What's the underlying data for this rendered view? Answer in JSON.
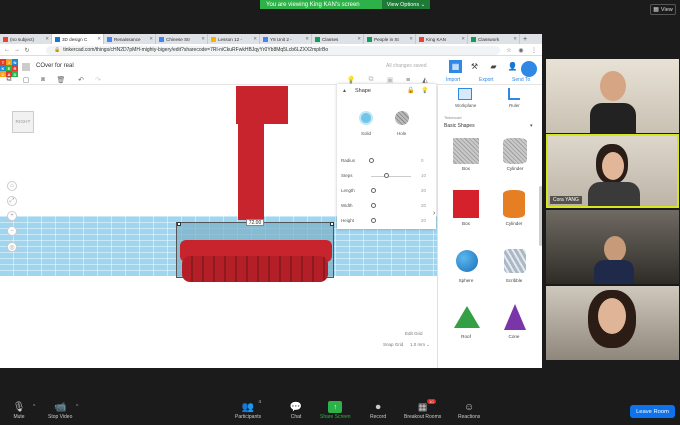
{
  "zoom": {
    "banner_text": "You are viewing King KAN's screen",
    "view_options": "View Options ⌄",
    "view_button": "View",
    "participants_count": "4",
    "breakout_badge": "10",
    "toolbar": {
      "mute": "Mute",
      "stop_video": "Stop Video",
      "participants": "Participants",
      "chat": "Chat",
      "share_screen": "Share Screen",
      "record": "Record",
      "breakout": "Breakout Rooms",
      "reactions": "Reactions",
      "leave": "Leave Room"
    },
    "tiles": [
      {
        "name": ""
      },
      {
        "name": "Cora YANG"
      },
      {
        "name": ""
      },
      {
        "name": ""
      }
    ]
  },
  "browser": {
    "tabs": [
      {
        "label": "(no subject)"
      },
      {
        "label": "3D design C"
      },
      {
        "label": "Renaissance"
      },
      {
        "label": "Chinese Str"
      },
      {
        "label": "Lesson 12 -"
      },
      {
        "label": "Y8 Unit 2 -"
      },
      {
        "label": "Classes"
      },
      {
        "label": "People in St"
      },
      {
        "label": "King KAN"
      },
      {
        "label": "Classwork"
      }
    ],
    "new_tab": "+",
    "url": "tinkercad.com/things/cHN2D7pMH-mighty-bigery/edit?sharecode=7Rl-niCkuRFwkHBJqyYr0Yb8Mq5Lcb6LZXX2mpIrBo"
  },
  "tinkercad": {
    "logo_letters": [
      "T",
      "I",
      "N",
      "K",
      "E",
      "R",
      "C",
      "A",
      "D"
    ],
    "doc_title": "COver for real",
    "saved_status": "All changes saved",
    "actions": {
      "import": "Import",
      "export": "Export",
      "send_to": "Send To"
    },
    "view_cube": "RIGHT",
    "dimension": "72.00",
    "edit_grid": "Edit Grid",
    "snap_grid_label": "Snap Grid",
    "snap_grid_value": "1.0 mm ⌄",
    "shape_panel": {
      "title": "Shape",
      "solid": "Solid",
      "hole": "Hole",
      "params": [
        {
          "label": "Radius",
          "value": "0"
        },
        {
          "label": "Steps",
          "value": "10"
        },
        {
          "label": "Length",
          "value": "20"
        },
        {
          "label": "Width",
          "value": "20"
        },
        {
          "label": "Height",
          "value": "20"
        }
      ]
    },
    "library": {
      "workplane": "Workplane",
      "ruler": "Ruler",
      "category_label": "Tinkercad",
      "category": "Basic Shapes",
      "shapes": [
        {
          "name": "Box"
        },
        {
          "name": "Cylinder"
        },
        {
          "name": "Box"
        },
        {
          "name": "Cylinder"
        },
        {
          "name": "Sphere"
        },
        {
          "name": "Scribble"
        },
        {
          "name": "Roof"
        },
        {
          "name": "Cone"
        }
      ]
    },
    "colors": {
      "accent": "#2f88e3",
      "red": "#c8242e",
      "workplane": "#9fd5ef",
      "zoom_green": "#2db24a",
      "leave": "#0e72ed"
    }
  }
}
